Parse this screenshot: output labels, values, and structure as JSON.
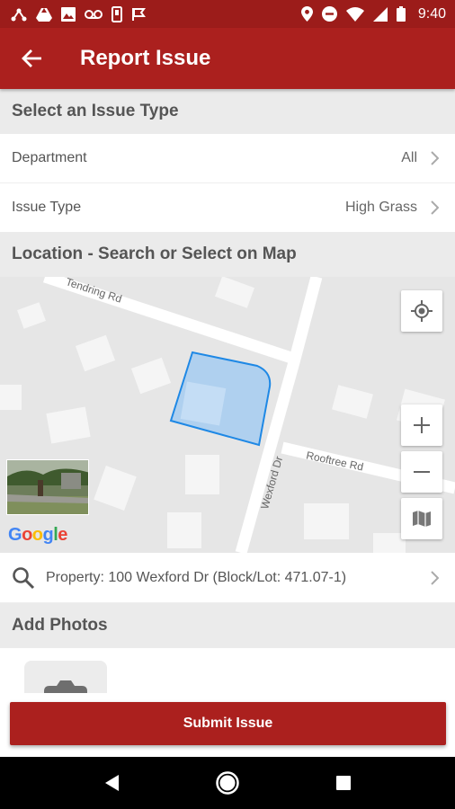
{
  "status_bar": {
    "time": "9:40",
    "left_icons": [
      "network-icon",
      "drive-icon",
      "image-icon",
      "voicemail-icon",
      "phone-icon",
      "flag-icon"
    ],
    "right_icons": [
      "location-icon",
      "do-not-disturb-icon",
      "wifi-icon",
      "signal-icon",
      "battery-icon"
    ]
  },
  "app_bar": {
    "title": "Report Issue"
  },
  "sections": {
    "issue_type_header": "Select an Issue Type",
    "location_header": "Location - Search or Select on Map",
    "photos_header": "Add Photos"
  },
  "department": {
    "label": "Department",
    "value": "All"
  },
  "issue_type": {
    "label": "Issue Type",
    "value": "High Grass"
  },
  "map": {
    "streets": {
      "tendring": "Tendring Rd",
      "wexford": "Wexford Dr",
      "rooftree": "Rooftree Rd"
    },
    "google_letters": [
      "G",
      "o",
      "o",
      "g",
      "l",
      "e"
    ],
    "google_colors": [
      "#4285F4",
      "#EA4335",
      "#FBBC05",
      "#4285F4",
      "#34A853",
      "#EA4335"
    ],
    "parcel_fill": "#a8cdf0",
    "parcel_stroke": "#1e88e5"
  },
  "property": {
    "text": "Property: 100 Wexford Dr  (Block/Lot: 471.07-1)"
  },
  "submit": {
    "label": "Submit Issue"
  },
  "colors": {
    "primary": "#ab201e",
    "status_bar": "#9c1c1a"
  }
}
